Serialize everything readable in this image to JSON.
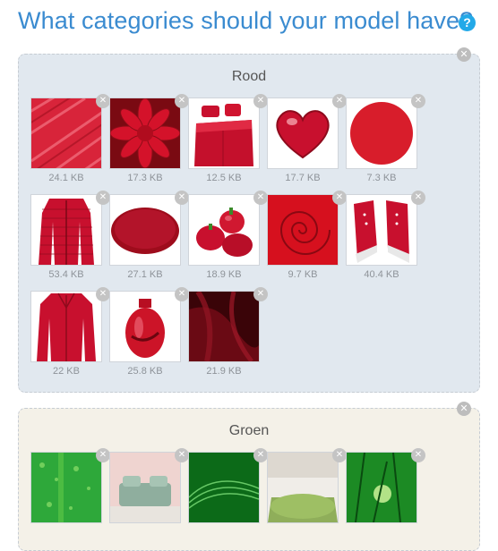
{
  "header": {
    "title": "What categories should your model have?",
    "help_icon": "question-circle-icon"
  },
  "categories": [
    {
      "name": "Rood",
      "color": "#e1e8ef",
      "images": [
        {
          "size": "24.1 KB",
          "subject": "red textured surface"
        },
        {
          "size": "17.3 KB",
          "subject": "red dahlia flower"
        },
        {
          "size": "12.5 KB",
          "subject": "red bedding"
        },
        {
          "size": "17.7 KB",
          "subject": "red heart"
        },
        {
          "size": "7.3 KB",
          "subject": "red circle"
        },
        {
          "size": "53.4 KB",
          "subject": "red jacket"
        },
        {
          "size": "27.1 KB",
          "subject": "red round rug"
        },
        {
          "size": "18.9 KB",
          "subject": "red peppers"
        },
        {
          "size": "9.7 KB",
          "subject": "red rose"
        },
        {
          "size": "40.4 KB",
          "subject": "red sneakers"
        },
        {
          "size": "22 KB",
          "subject": "red cardigan"
        },
        {
          "size": "25.8 KB",
          "subject": "red vase"
        },
        {
          "size": "21.9 KB",
          "subject": "dark red silk"
        }
      ]
    },
    {
      "name": "Groen",
      "color": "#f4f1e8",
      "images": [
        {
          "size": "",
          "subject": "green water drops"
        },
        {
          "size": "",
          "subject": "green sofa in room"
        },
        {
          "size": "",
          "subject": "green abstract waves"
        },
        {
          "size": "",
          "subject": "green shaggy rug"
        },
        {
          "size": "",
          "subject": "green grass sunlight"
        }
      ]
    }
  ]
}
